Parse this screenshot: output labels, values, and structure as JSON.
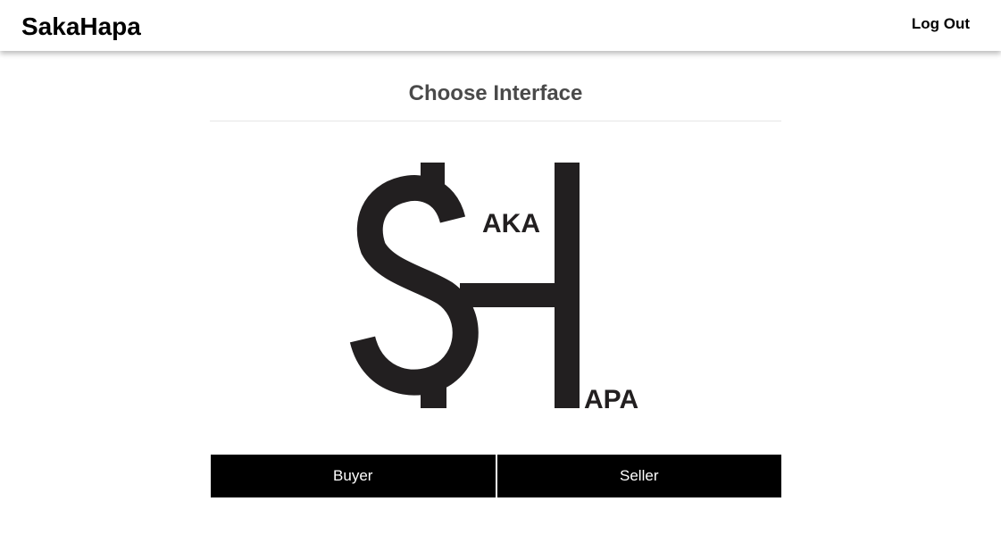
{
  "navbar": {
    "brand": "SakaHapa",
    "logout_label": "Log Out"
  },
  "main": {
    "title": "Choose Interface",
    "logo": {
      "text_top": "AKA",
      "text_bottom": "APA",
      "color": "#221f20"
    },
    "options": [
      {
        "label": "Buyer"
      },
      {
        "label": "Seller"
      }
    ]
  },
  "colors": {
    "button_bg": "#000000",
    "button_text": "#ffffff",
    "heading": "#4a4a4a",
    "logo": "#221f20"
  }
}
